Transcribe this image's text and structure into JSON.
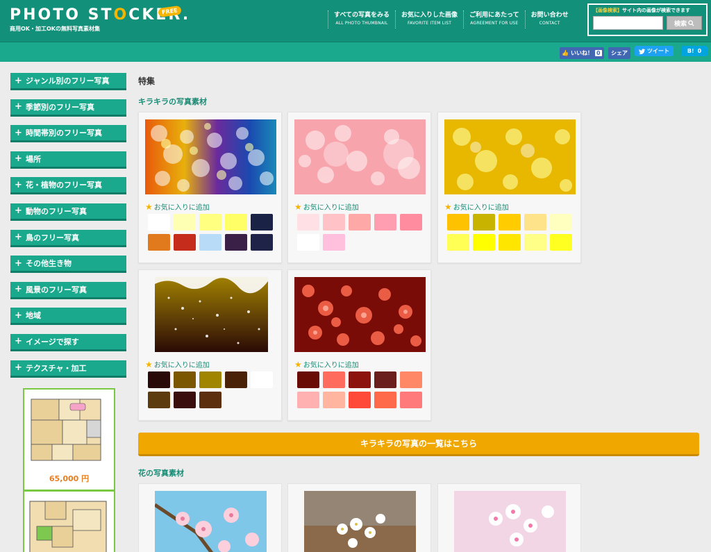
{
  "header": {
    "logo_main": "PHOTO ST",
    "logo_o": "O",
    "logo_rest": "CKER.",
    "logo_badge": "FREE",
    "logo_sub": "商用OK・加工OKの無料写真素材集",
    "nav": [
      {
        "jp": "すべての写真をみる",
        "en": "ALL PHOTO THUMBNAIL"
      },
      {
        "jp": "お気に入りした画像",
        "en": "FAVORITE ITEM LIST"
      },
      {
        "jp": "ご利用にあたって",
        "en": "AGREEMENT FOR USE"
      },
      {
        "jp": "お問い合わせ",
        "en": "CONTACT"
      }
    ],
    "search": {
      "tag": "【画像検索】",
      "desc": "サイト内の画像が検索できます",
      "button": "検索",
      "value": ""
    }
  },
  "sharebar": {
    "like_label": "いいね！",
    "like_count": "0",
    "share_label": "シェア",
    "tweet_label": "ツイート",
    "hatena_label": "B!",
    "hatena_count": "0"
  },
  "sidebar": {
    "items": [
      "ジャンル別のフリー写真",
      "季節別のフリー写真",
      "時間帯別のフリー写真",
      "場所",
      "花・植物のフリー写真",
      "動物のフリー写真",
      "鳥のフリー写真",
      "その他生き物",
      "風景のフリー写真",
      "地域",
      "イメージで探す",
      "テクスチャ・加工"
    ],
    "ad_price": "65,000 円"
  },
  "main": {
    "section_title": "特集",
    "kirakira_title": "キラキラの写真素材",
    "fav_label": "お気に入りに追加",
    "cta_label": "キラキラの写真の一覧はこちら",
    "flower_title": "花の写真素材"
  },
  "palettes": [
    [
      "#ffffff",
      "#ffffb3",
      "#ffff80",
      "#ffff66",
      "#1a2346",
      "#e07a1c",
      "#c62c1c",
      "#b8dcf7",
      "#3a1f47",
      "#1f2348"
    ],
    [
      "#ffe0e4",
      "#ffc2c6",
      "#ffa8a8",
      "#ff9eb0",
      "#ff8c9f",
      "#ffffff",
      "#ffc0dd"
    ],
    [
      "#ffc200",
      "#c8b400",
      "#ffcc00",
      "#ffe38a",
      "#ffffbf",
      "#ffff55",
      "#ffff00",
      "#ffe600",
      "#ffff88",
      "#ffff22"
    ],
    [
      "#2a0a08",
      "#7a5700",
      "#a08500",
      "#4a2208",
      "#ffffff",
      "#5c3b0e",
      "#3a0e0c",
      "#5c2f0e"
    ],
    [
      "#6a0c06",
      "#ff6c5e",
      "#8c120e",
      "#6a1f1c",
      "#ff8866",
      "#ffb0b0",
      "#ffb5a0",
      "#ff4a3a",
      "#ff6a4a",
      "#ff7a7a"
    ]
  ]
}
